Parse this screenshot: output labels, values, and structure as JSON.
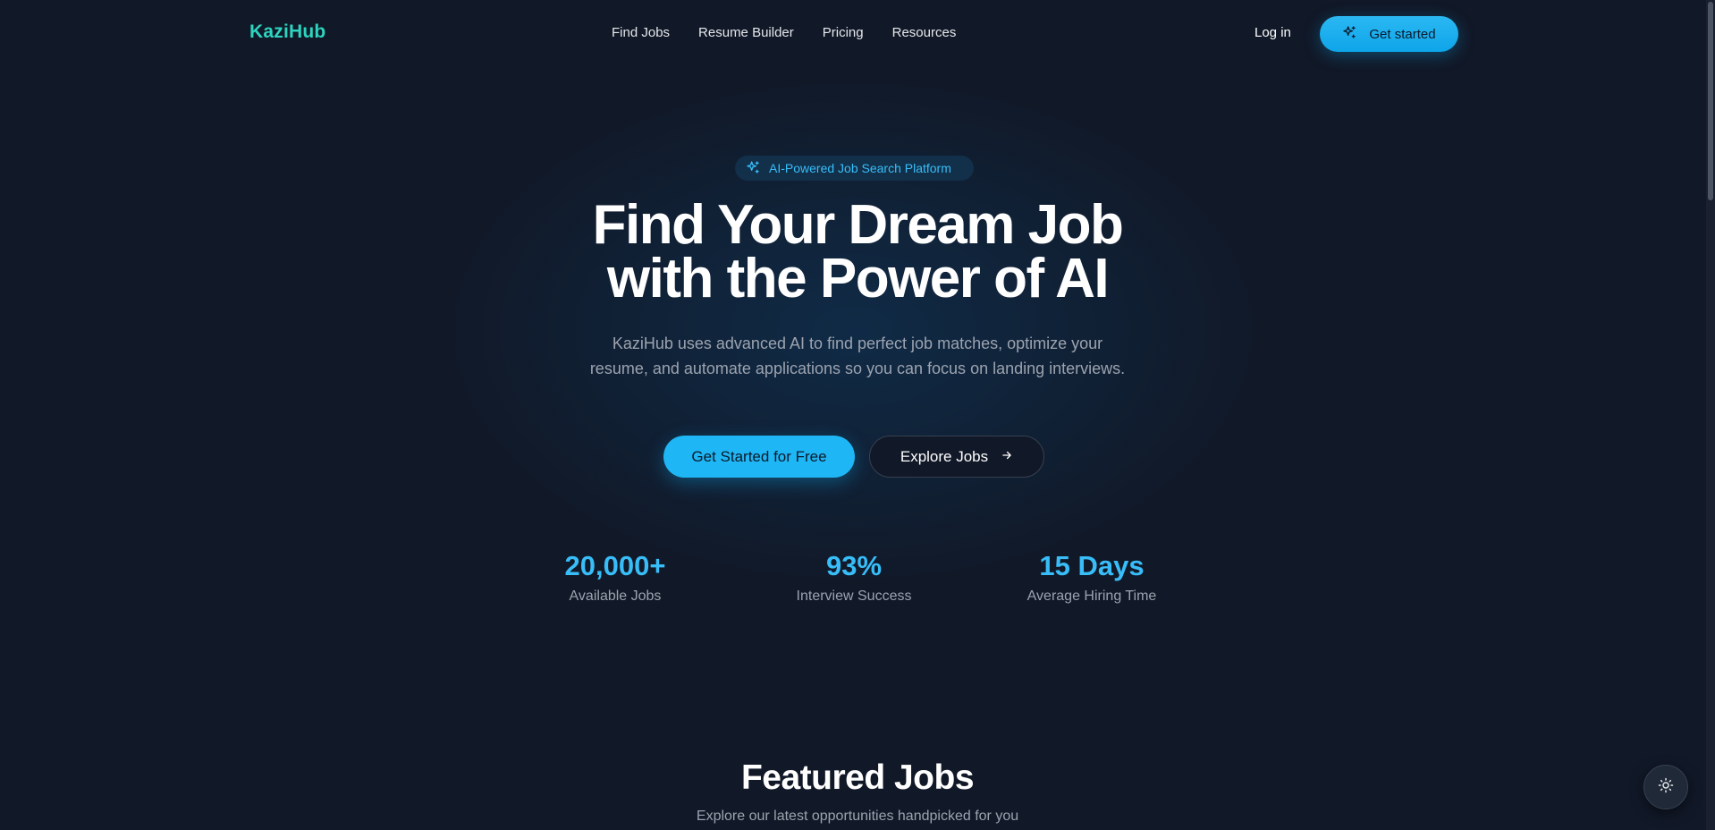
{
  "colors": {
    "background": "#111827",
    "accent": "#0ea5e9",
    "logo": "#2dd4bf",
    "stat": "#38bdf8"
  },
  "nav": {
    "logo": "KaziHub",
    "links": [
      "Find Jobs",
      "Resume Builder",
      "Pricing",
      "Resources"
    ],
    "login": "Log in",
    "cta": {
      "label": "Get started",
      "icon": "sparkles-icon"
    }
  },
  "hero": {
    "badge": {
      "label": "AI-Powered Job Search Platform",
      "icon": "sparkles-icon"
    },
    "title_line1": "Find Your Dream Job",
    "title_line2": "with the Power of AI",
    "subtitle": "KaziHub uses advanced AI to find perfect job matches, optimize your resume, and automate applications so you can focus on landing interviews.",
    "primary_button": "Get Started for Free",
    "secondary_button": {
      "label": "Explore Jobs",
      "icon": "arrow-right-icon"
    }
  },
  "stats": [
    {
      "value": "20,000+",
      "label": "Available Jobs"
    },
    {
      "value": "93%",
      "label": "Interview Success"
    },
    {
      "value": "15 Days",
      "label": "Average Hiring Time"
    }
  ],
  "featured": {
    "title": "Featured Jobs",
    "subtitle": "Explore our latest opportunities handpicked for you"
  },
  "theme_toggle": {
    "icon": "sun-icon"
  }
}
